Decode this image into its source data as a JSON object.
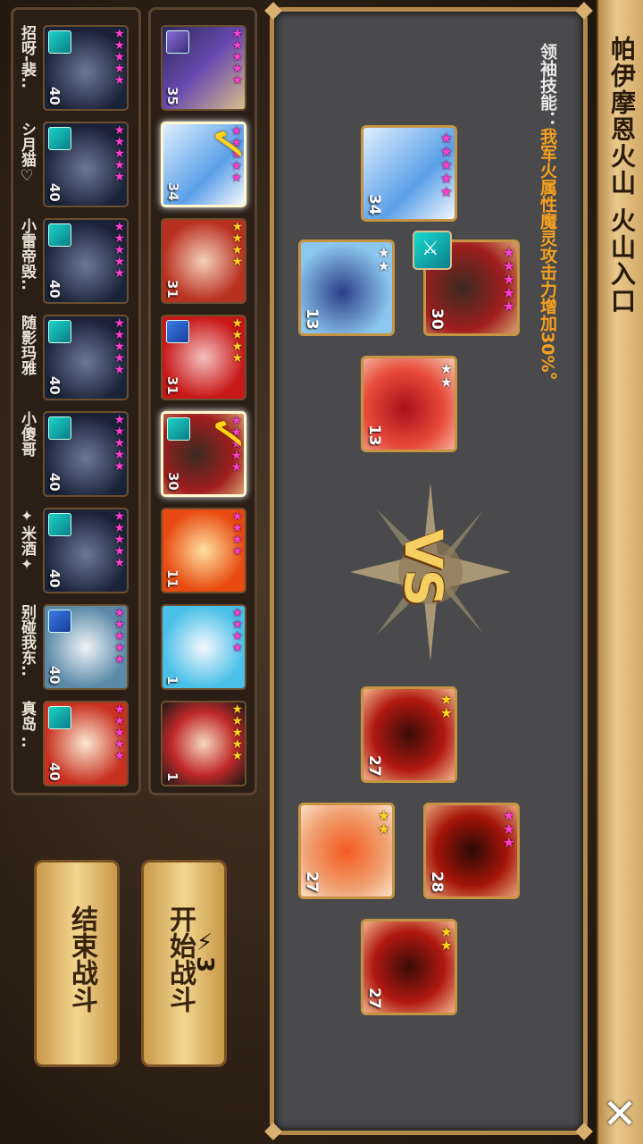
{
  "title": "帕伊摩恩火山 火山入口",
  "close_label": "✕",
  "leader": {
    "label": "领袖技能：",
    "value": "我军火属性魔灵攻击力增加30%。"
  },
  "vs_label": "VS",
  "my_team": [
    {
      "level": "34",
      "stars": 5,
      "star_color": "pink"
    },
    {
      "level": "13",
      "stars": 2,
      "star_color": "silver"
    },
    {
      "level": "30",
      "stars": 5,
      "star_color": "pink"
    },
    {
      "level": "13",
      "stars": 2,
      "star_color": "silver"
    }
  ],
  "enemy_team": [
    {
      "level": "27",
      "stars": 2,
      "star_color": "gold"
    },
    {
      "level": "27",
      "stars": 2,
      "star_color": "gold"
    },
    {
      "level": "28",
      "stars": 3,
      "star_color": "pink"
    },
    {
      "level": "27",
      "stars": 2,
      "star_color": "gold"
    }
  ],
  "roster": [
    {
      "level": "35",
      "stars": 5,
      "star_color": "pink",
      "selected": false
    },
    {
      "level": "34",
      "stars": 5,
      "star_color": "pink",
      "selected": true
    },
    {
      "level": "31",
      "stars": 4,
      "star_color": "gold",
      "selected": false
    },
    {
      "level": "31",
      "stars": 4,
      "star_color": "gold",
      "selected": false
    },
    {
      "level": "30",
      "stars": 5,
      "star_color": "pink",
      "selected": true
    },
    {
      "level": "11",
      "stars": 4,
      "star_color": "pink",
      "selected": false
    },
    {
      "level": "1",
      "stars": 4,
      "star_color": "pink",
      "selected": false
    },
    {
      "level": "1",
      "stars": 5,
      "star_color": "gold",
      "selected": false
    }
  ],
  "friends": [
    {
      "name": "招呀-裴..",
      "level": "40",
      "stars": 5
    },
    {
      "name": "シ月猫♡",
      "level": "40",
      "stars": 5
    },
    {
      "name": "小雷帝毁..",
      "level": "40",
      "stars": 5
    },
    {
      "name": "随影玛雅",
      "level": "40",
      "stars": 5
    },
    {
      "name": "小傻哥",
      "level": "40",
      "stars": 5
    },
    {
      "name": "✦米酒✦",
      "level": "40",
      "stars": 5
    },
    {
      "name": "别碰我东..",
      "level": "40",
      "stars": 5
    },
    {
      "name": "真岛 ..",
      "level": "40",
      "stars": 5
    }
  ],
  "buttons": {
    "start": "开始战斗",
    "start_cost": "3",
    "end": "结束战斗"
  },
  "colors": {
    "frame_gold": "#c69442",
    "star_pink": "#ff3ed0",
    "star_gold": "#ffd21c",
    "leader_value": "#f5a020"
  }
}
